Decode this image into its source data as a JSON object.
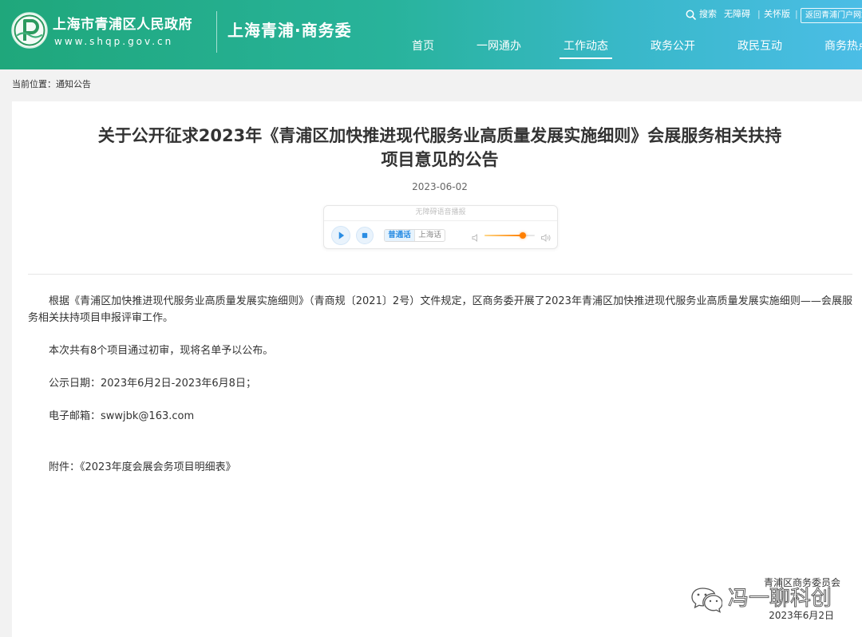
{
  "site": {
    "government_name": "上海市青浦区人民政府",
    "domain": "www.shqp.gov.cn",
    "department_name": "上海青浦·商务委",
    "logo_icon": "qingpu-emblem-icon"
  },
  "top_links": {
    "search_icon": "search-icon",
    "search": "搜索",
    "accessibility": "无障碍",
    "separator": "|",
    "care_mode": "关怀版",
    "portal": "返回青浦门户网站"
  },
  "nav": [
    {
      "label": "首页",
      "active": false
    },
    {
      "label": "一网通办",
      "active": false
    },
    {
      "label": "工作动态",
      "active": true
    },
    {
      "label": "政务公开",
      "active": false
    },
    {
      "label": "政民互动",
      "active": false
    },
    {
      "label": "商务热点",
      "active": false
    }
  ],
  "breadcrumb": {
    "prefix": "当前位置：",
    "current": "通知公告"
  },
  "article": {
    "title_lines": [
      "关于公开征求2023年《青浦区加快推进现代服务业高质量发展实施细则》会展服务相关扶持",
      "项目意见的公告"
    ],
    "date": "2023-06-02",
    "paragraphs": [
      "根据《青浦区加快推进现代服务业高质量发展实施细则》（青商规〔2021〕2号）文件规定，区商务委开展了2023年青浦区加快推进现代服务业高质量发展实施细则——会展服务相关扶持项目申报评审工作。",
      "本次共有8个项目通过初审，现将名单予以公布。",
      "公示日期：2023年6月2日-2023年6月8日；",
      "电子邮箱：swwjbk@163.com"
    ],
    "attachment": {
      "label": "附件：",
      "name": "《2023年度会展会务项目明细表》"
    },
    "signature": {
      "org": "青浦区商务委员会",
      "date": "2023年6月2日"
    }
  },
  "audio_player": {
    "label": "无障碍语音播报",
    "play_icon": "play-icon",
    "stop_icon": "stop-icon",
    "languages": [
      "普通话",
      "上海话"
    ],
    "selected_index": 0,
    "volume_low_icon": "volume-low-icon",
    "volume_high_icon": "volume-high-icon",
    "volume": 0.76
  },
  "watermark": {
    "icon": "wechat-icon",
    "text": "冯一聊科创"
  },
  "colors": {
    "header_gradient_start": "#1fa77b",
    "header_gradient_end": "#4bbde6",
    "accent_blue": "#2b8de3",
    "volume_orange": "#ff7f00",
    "page_background": "#f2f2f2",
    "text": "#333333"
  }
}
